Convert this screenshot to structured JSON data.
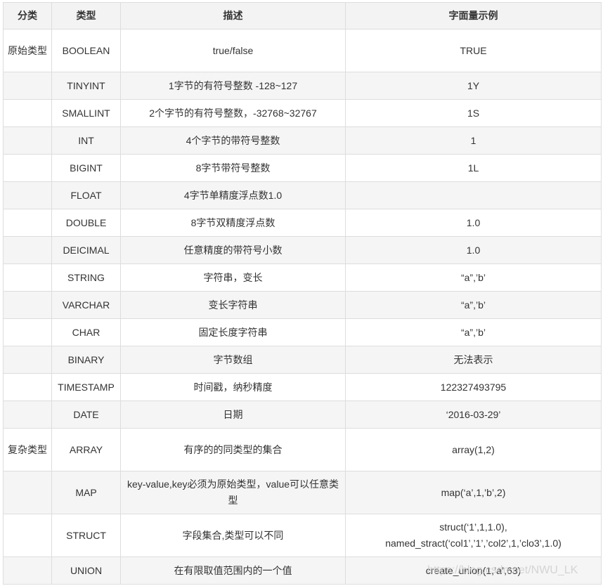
{
  "headers": [
    "分类",
    "类型",
    "描述",
    "字面量示例"
  ],
  "rows": [
    {
      "category": "原始类型",
      "type": "BOOLEAN",
      "desc": "true/false",
      "example": "TRUE",
      "tall": true
    },
    {
      "category": "",
      "type": "TINYINT",
      "desc": "1字节的有符号整数 -128~127",
      "example": "1Y"
    },
    {
      "category": "",
      "type": "SMALLINT",
      "desc": "2个字节的有符号整数，-32768~32767",
      "example": "1S"
    },
    {
      "category": "",
      "type": "INT",
      "desc": "4个字节的带符号整数",
      "example": "1"
    },
    {
      "category": "",
      "type": "BIGINT",
      "desc": "8字节带符号整数",
      "example": "1L"
    },
    {
      "category": "",
      "type": "FLOAT",
      "desc": "4字节单精度浮点数1.0",
      "example": ""
    },
    {
      "category": "",
      "type": "DOUBLE",
      "desc": "8字节双精度浮点数",
      "example": "1.0"
    },
    {
      "category": "",
      "type": "DEICIMAL",
      "desc": "任意精度的带符号小数",
      "example": "1.0"
    },
    {
      "category": "",
      "type": "STRING",
      "desc": "字符串，变长",
      "example": "“a”,’b’"
    },
    {
      "category": "",
      "type": "VARCHAR",
      "desc": "变长字符串",
      "example": "“a”,’b’"
    },
    {
      "category": "",
      "type": "CHAR",
      "desc": "固定长度字符串",
      "example": "“a”,’b’"
    },
    {
      "category": "",
      "type": "BINARY",
      "desc": "字节数组",
      "example": "无法表示"
    },
    {
      "category": "",
      "type": "TIMESTAMP",
      "desc": "时间戳，纳秒精度",
      "example": "122327493795"
    },
    {
      "category": "",
      "type": "DATE",
      "desc": "日期",
      "example": "‘2016-03-29’"
    },
    {
      "category": "复杂类型",
      "type": "ARRAY",
      "desc": "有序的的同类型的集合",
      "example": "array(1,2)",
      "tall": true
    },
    {
      "category": "",
      "type": "MAP",
      "desc": "key-value,key必须为原始类型，value可以任意类型",
      "example": "map(‘a’,1,’b’,2)",
      "tall": true
    },
    {
      "category": "",
      "type": "STRUCT",
      "desc": "字段集合,类型可以不同",
      "example": "struct(‘1’,1,1.0), named_stract(‘col1’,’1’,’col2’,1,’clo3’,1.0)",
      "tall": true
    },
    {
      "category": "",
      "type": "UNION",
      "desc": "在有限取值范围内的一个值",
      "example": "create_union(1,’a’,63)"
    }
  ],
  "watermark": "https://blog.csdn.net/NWU_LK"
}
